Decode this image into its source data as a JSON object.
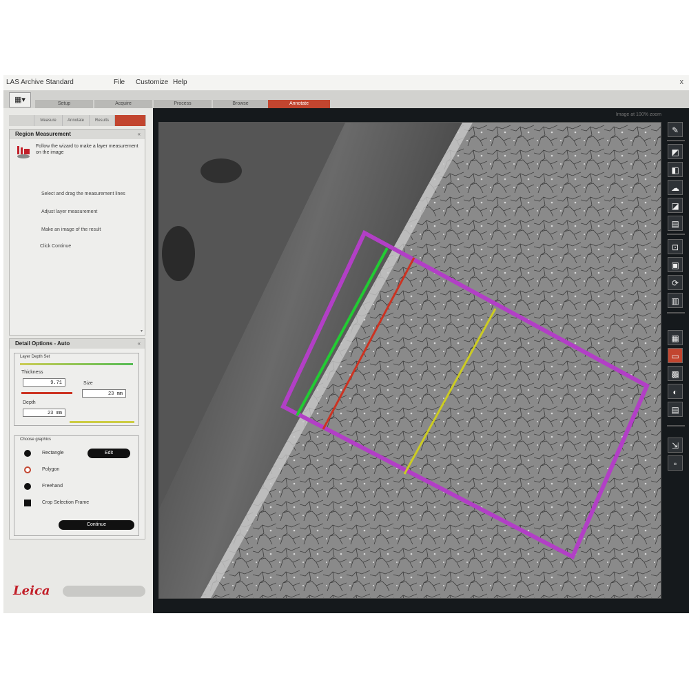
{
  "titlebar": {
    "title": "LAS Archive Standard",
    "menus": [
      "File",
      "Customize",
      "Help"
    ],
    "close": "x"
  },
  "workflow_tabs": [
    "Setup",
    "Acquire",
    "Process",
    "Browse",
    "Annotate"
  ],
  "active_workflow_tab": "Annotate",
  "home_icon": "grid-view-icon",
  "left_panel": {
    "subtabs": [
      "",
      "Measure",
      "Annotate",
      "Results",
      ""
    ],
    "active_subtab": 4,
    "wizard": {
      "title": "Region Measurement",
      "instructions": "Follow the wizard to make a layer measurement on the image",
      "steps": [
        "Select and drag the measurement lines",
        "Adjust layer measurement",
        "Make an image of the result",
        "Click Continue"
      ],
      "scroll": "▾"
    },
    "options": {
      "title": "Detail Options - Auto",
      "group_label": "Layer Depth Set",
      "thickness_label": "Thickness",
      "thickness_value": "9.71",
      "size_label": "Size",
      "size_value": "23 mm",
      "depth_label": "Depth",
      "depth_value": "23 mm",
      "choose_label": "Choose graphics",
      "radios": [
        "Rectangle",
        "Polygon",
        "Freehand"
      ],
      "checkbox_label": "Crop Selection Frame",
      "edit_button": "Edit",
      "continue_button": "Continue"
    }
  },
  "logo": "Leica",
  "progress_label": "",
  "viewer_status": "Image at 100% zoom",
  "toolbar_icons": [
    "draw-line-icon",
    "crop-icon",
    "area-icon",
    "rectangle-icon",
    "polygon-icon",
    "freehand-icon",
    "zoom-icon",
    "snapshot-icon",
    "rotate-icon",
    "ruler-icon",
    "rectangle-select-icon",
    "grid-icon",
    "overlay-icon",
    "contrast-icon",
    "export-icon"
  ],
  "active_toolbar_icon": "rectangle-select-icon",
  "colors": {
    "accent": "#c2452f",
    "overlay_frame": "#b23fc6",
    "edge_line": "#22cc33",
    "inner_line": "#cc3322",
    "measure_line": "#cccc22"
  }
}
